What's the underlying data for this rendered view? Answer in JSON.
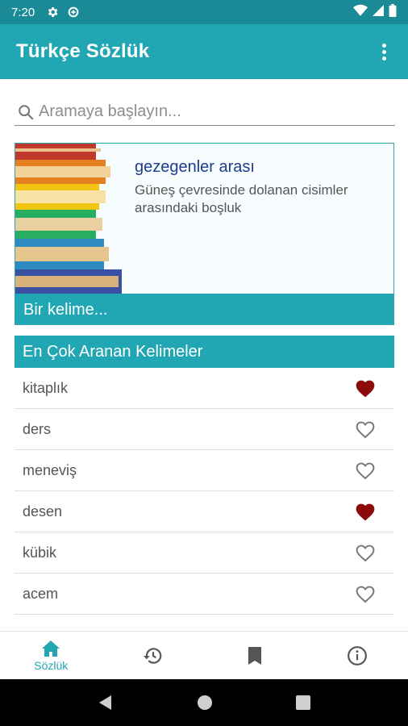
{
  "status_bar": {
    "time": "7:20"
  },
  "app_bar": {
    "title": "Türkçe Sözlük"
  },
  "search": {
    "placeholder": "Aramaya başlayın..."
  },
  "word_card": {
    "word": "gezegenler arası",
    "definition": "Güneş çevresinde dolanan cisimler arasındaki boşluk",
    "footer": "Bir kelime..."
  },
  "most_searched": {
    "title": "En Çok Aranan Kelimeler",
    "items": [
      {
        "word": "kitaplık",
        "favorite": true
      },
      {
        "word": "ders",
        "favorite": false
      },
      {
        "word": "meneviş",
        "favorite": false
      },
      {
        "word": "desen",
        "favorite": true
      },
      {
        "word": "kübik",
        "favorite": false
      },
      {
        "word": "acem",
        "favorite": false
      }
    ]
  },
  "bottom_nav": {
    "active_label": "Sözlük"
  },
  "colors": {
    "accent": "#21a6b3",
    "favorite": "#8b0a0a",
    "word": "#1e3d8a"
  }
}
